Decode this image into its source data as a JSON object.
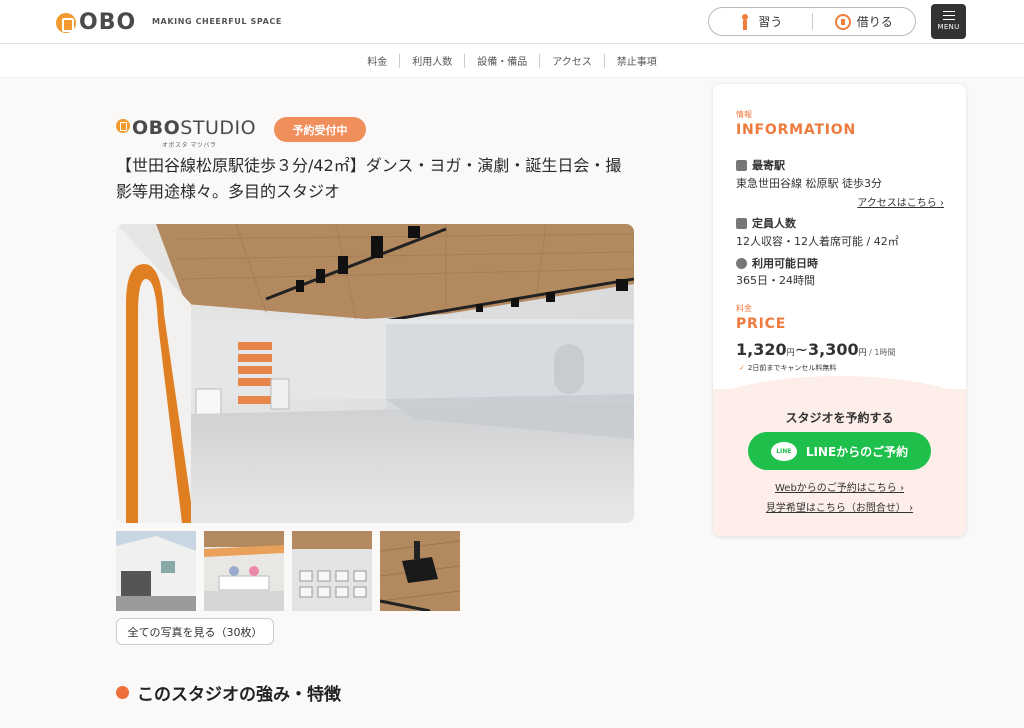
{
  "header": {
    "logo": "OBO",
    "tagline": "MAKING CHEERFUL SPACE",
    "nav": [
      {
        "label": "習う",
        "icon": "person-icon"
      },
      {
        "label": "借りる",
        "icon": "key-icon"
      }
    ],
    "menu_label": "MENU"
  },
  "subnav": [
    "料金",
    "利用人数",
    "設備・備品",
    "アクセス",
    "禁止事項"
  ],
  "studio": {
    "brand_bold": "OBO",
    "brand_light": "STUDIO",
    "brand_kana": "オボスタ マツバラ",
    "status_badge": "予約受付中",
    "title": "【世田谷線松原駅徒歩３分/42㎡】ダンス・ヨガ・演劇・誕生日会・撮影等用途様々。多目的スタジオ",
    "all_photos_button": "全ての写真を見る（30枚）",
    "section_heading": "このスタジオの強み・特徴"
  },
  "info": {
    "small_label": "情報",
    "heading": "INFORMATION",
    "station_label": "最寄駅",
    "station_value": "東急世田谷線 松原駅 徒歩3分",
    "access_link": "アクセスはこちら",
    "capacity_label": "定員人数",
    "capacity_value": "12人収容・12人着席可能 /  42㎡",
    "hours_label": "利用可能日時",
    "hours_value": "365日・24時間",
    "price_small": "料金",
    "price_heading": "PRICE",
    "price_min": "1,320",
    "price_max": "3,300",
    "price_unit": "円",
    "price_sep": "~",
    "price_per": " / 1時間",
    "cancel_note": "2日前までキャンセル料無料",
    "reserve_title": "スタジオを予約する",
    "line_button": "LINEからのご予約",
    "line_icon_text": "LINE",
    "web_link": "Webからのご予約はこちら",
    "visit_link": "見学希望はこちら（お問合せ）"
  },
  "colors": {
    "accent": "#ee7a3e",
    "badge": "#f08f5c",
    "line_green": "#1fbf4c",
    "card_pink": "#fdeee9"
  }
}
